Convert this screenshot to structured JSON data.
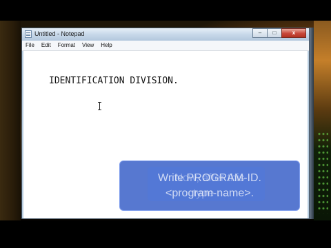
{
  "window": {
    "title": "Untitled - Notepad",
    "buttons": {
      "minimize": "–",
      "maximize": "□",
      "close": "x"
    }
  },
  "menu": {
    "items": [
      "File",
      "Edit",
      "Format",
      "View",
      "Help"
    ]
  },
  "editor": {
    "content": "IDENTIFICATION DIVISION."
  },
  "caption": {
    "line1_front": "Write PROGRAM-ID.",
    "line2_front": "<program-name>.",
    "line1_back": "Now, after this",
    "line2_back": "type . .",
    "colors": {
      "background": "#3a60c8"
    }
  },
  "icons": {
    "app": "notepad-icon",
    "cursor": "text-cursor-icon"
  }
}
